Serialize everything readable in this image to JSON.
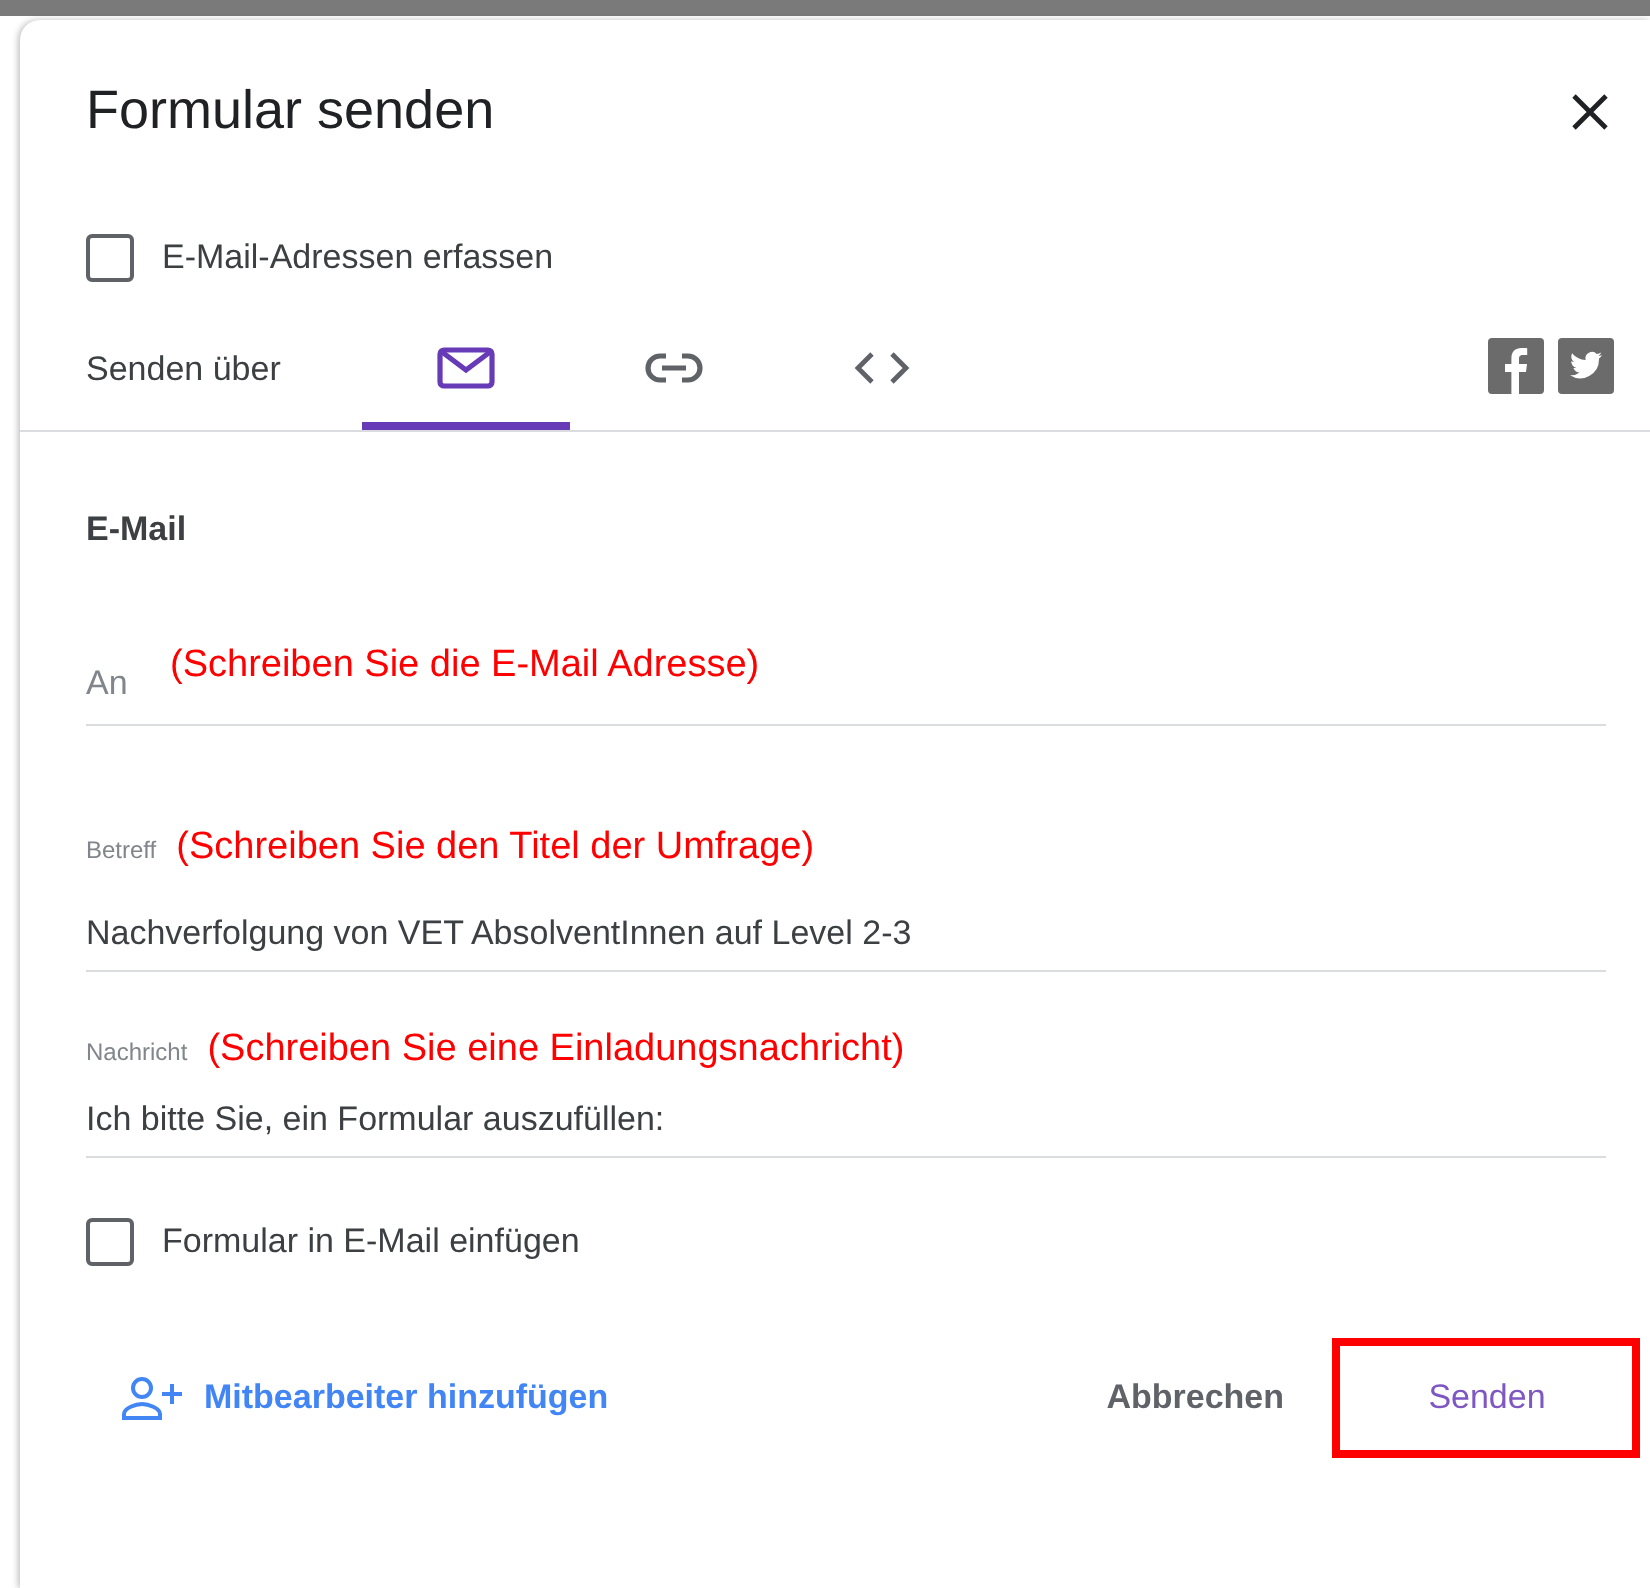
{
  "dialog": {
    "title": "Formular senden"
  },
  "collect_emails": {
    "label": "E-Mail-Adressen erfassen",
    "checked": false
  },
  "send_via": {
    "label": "Senden über",
    "tabs": [
      {
        "kind": "email",
        "selected": true
      },
      {
        "kind": "link",
        "selected": false
      },
      {
        "kind": "embed",
        "selected": false
      }
    ],
    "share": [
      {
        "kind": "facebook"
      },
      {
        "kind": "twitter"
      }
    ]
  },
  "section_title": "E-Mail",
  "fields": [
    {
      "kind": "to",
      "placeholder": "An",
      "annotation": "(Schreiben Sie die E-Mail Adresse)"
    },
    {
      "kind": "subject",
      "label": "Betreff",
      "annotation": "(Schreiben Sie den Titel der Umfrage)",
      "value": "Nachverfolgung von VET AbsolventInnen auf Level 2-3"
    },
    {
      "kind": "message",
      "label": "Nachricht",
      "annotation": "(Schreiben Sie eine Einladungsnachricht)",
      "value": "Ich bitte Sie, ein Formular auszufüllen:"
    }
  ],
  "include_form": {
    "label": "Formular in E-Mail einfügen",
    "checked": false
  },
  "add_collaborators": "Mitbearbeiter hinzufügen",
  "buttons": [
    {
      "kind": "cancel",
      "label": "Abbrechen",
      "highlighted": false
    },
    {
      "kind": "send",
      "label": "Senden",
      "highlighted": true
    }
  ]
}
